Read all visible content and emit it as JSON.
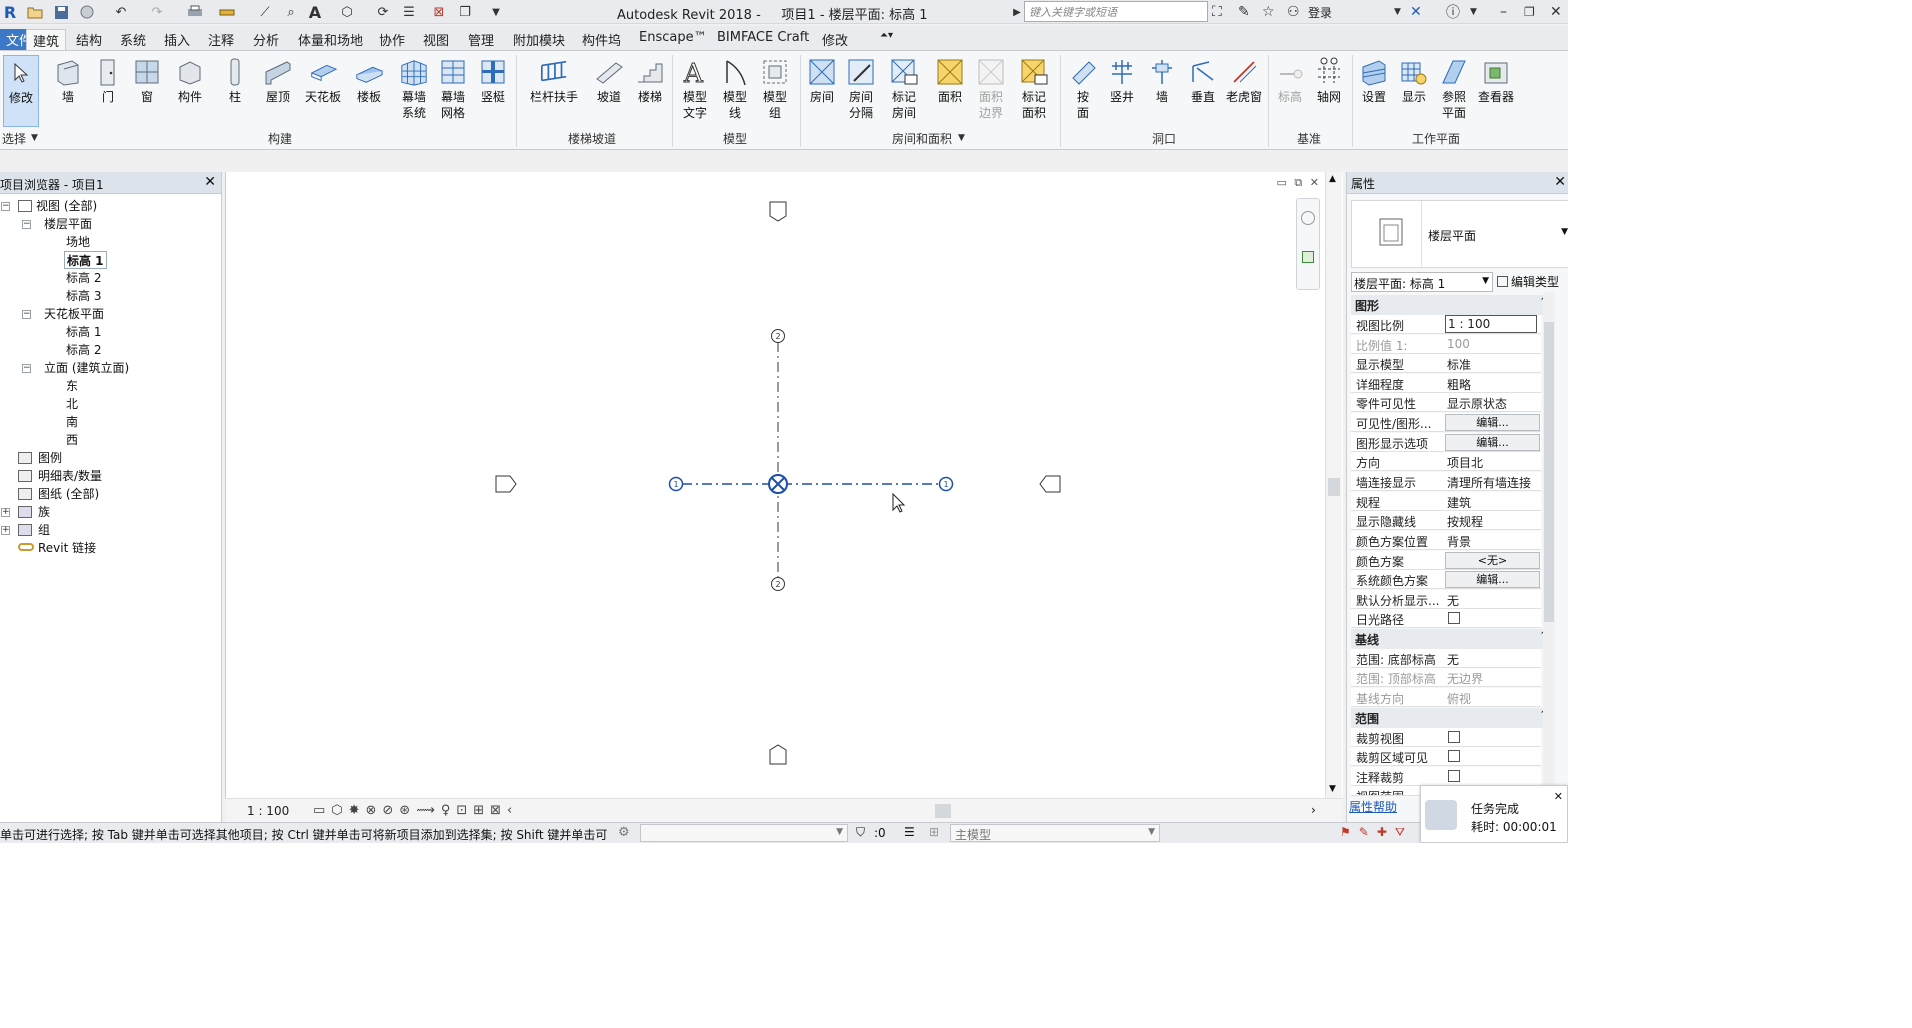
{
  "app": {
    "logo": "R",
    "title": "Autodesk Revit 2018 -     项目1 - 楼层平面: 标高 1",
    "search_placeholder": "键入关键字或短语",
    "login": "登录"
  },
  "tabs": [
    {
      "label": "文件"
    },
    {
      "label": "建筑",
      "active": true
    },
    {
      "label": "结构"
    },
    {
      "label": "系统"
    },
    {
      "label": "插入"
    },
    {
      "label": "注释"
    },
    {
      "label": "分析"
    },
    {
      "label": "体量和场地"
    },
    {
      "label": "协作"
    },
    {
      "label": "视图"
    },
    {
      "label": "管理"
    },
    {
      "label": "附加模块"
    },
    {
      "label": "构件坞"
    },
    {
      "label": "Enscape™"
    },
    {
      "label": "BIMFACE Craft"
    },
    {
      "label": "修改"
    }
  ],
  "ribbon": {
    "buttons": [
      {
        "label": "修改"
      },
      {
        "label": "墙"
      },
      {
        "label": "门"
      },
      {
        "label": "窗"
      },
      {
        "label": "构件"
      },
      {
        "label": "柱"
      },
      {
        "label": "屋顶"
      },
      {
        "label": "天花板"
      },
      {
        "label": "楼板"
      },
      {
        "label": "幕墙\n系统"
      },
      {
        "label": "幕墙\n网格"
      },
      {
        "label": "竖梃"
      },
      {
        "label": "栏杆扶手"
      },
      {
        "label": "坡道"
      },
      {
        "label": "楼梯"
      },
      {
        "label": "模型\n文字"
      },
      {
        "label": "模型\n线"
      },
      {
        "label": "模型\n组"
      },
      {
        "label": "房间"
      },
      {
        "label": "房间\n分隔"
      },
      {
        "label": "标记\n房间"
      },
      {
        "label": "面积"
      },
      {
        "label": "面积\n边界"
      },
      {
        "label": "标记\n面积"
      },
      {
        "label": "按\n面"
      },
      {
        "label": "竖井"
      },
      {
        "label": "墙"
      },
      {
        "label": "垂直"
      },
      {
        "label": "老虎窗"
      },
      {
        "label": "标高"
      },
      {
        "label": "轴网"
      },
      {
        "label": "设置"
      },
      {
        "label": "显示"
      },
      {
        "label": "参照\n平面"
      },
      {
        "label": "查看器"
      }
    ],
    "panels": [
      {
        "label": "选择"
      },
      {
        "label": "构建"
      },
      {
        "label": "楼梯坡道"
      },
      {
        "label": "模型"
      },
      {
        "label": "房间和面积"
      },
      {
        "label": "洞口"
      },
      {
        "label": "基准"
      },
      {
        "label": "工作平面"
      }
    ]
  },
  "browser": {
    "title": "项目浏览器 - 项目1",
    "items": [
      {
        "label": "视图 (全部)"
      },
      {
        "label": "楼层平面"
      },
      {
        "label": "场地"
      },
      {
        "label": "标高 1"
      },
      {
        "label": "标高 2"
      },
      {
        "label": "标高 3"
      },
      {
        "label": "天花板平面"
      },
      {
        "label": "标高 1"
      },
      {
        "label": "标高 2"
      },
      {
        "label": "立面 (建筑立面)"
      },
      {
        "label": "东"
      },
      {
        "label": "北"
      },
      {
        "label": "南"
      },
      {
        "label": "西"
      },
      {
        "label": "图例"
      },
      {
        "label": "明细表/数量"
      },
      {
        "label": "图纸 (全部)"
      },
      {
        "label": "族"
      },
      {
        "label": "组"
      },
      {
        "label": "Revit 链接"
      }
    ]
  },
  "canvas": {
    "scale": "1 : 100",
    "grid_bubbles": [
      "1",
      "1",
      "2",
      "2"
    ]
  },
  "properties": {
    "title": "属性",
    "type_name": "楼层平面",
    "selector": "楼层平面: 标高 1",
    "edit_type": "编辑类型",
    "sections": {
      "graphics": "图形",
      "underlay": "基线",
      "extents": "范围"
    },
    "rows": [
      {
        "k": "视图比例",
        "v": "1 : 100"
      },
      {
        "k": "比例值 1:",
        "v": "100"
      },
      {
        "k": "显示模型",
        "v": "标准"
      },
      {
        "k": "详细程度",
        "v": "粗略"
      },
      {
        "k": "零件可见性",
        "v": "显示原状态"
      },
      {
        "k": "可见性/图形...",
        "v": "编辑..."
      },
      {
        "k": "图形显示选项",
        "v": "编辑..."
      },
      {
        "k": "方向",
        "v": "项目北"
      },
      {
        "k": "墙连接显示",
        "v": "清理所有墙连接"
      },
      {
        "k": "规程",
        "v": "建筑"
      },
      {
        "k": "显示隐藏线",
        "v": "按规程"
      },
      {
        "k": "颜色方案位置",
        "v": "背景"
      },
      {
        "k": "颜色方案",
        "v": "<无>"
      },
      {
        "k": "系统颜色方案",
        "v": "编辑..."
      },
      {
        "k": "默认分析显示...",
        "v": "无"
      },
      {
        "k": "日光路径",
        "v": ""
      },
      {
        "k": "范围: 底部标高",
        "v": "无"
      },
      {
        "k": "范围: 顶部标高",
        "v": "无边界"
      },
      {
        "k": "基线方向",
        "v": "俯视"
      },
      {
        "k": "裁剪视图",
        "v": ""
      },
      {
        "k": "裁剪区域可见",
        "v": ""
      },
      {
        "k": "注释裁剪",
        "v": ""
      },
      {
        "k": "视图范围",
        "v": ""
      }
    ],
    "help_link": "属性帮助"
  },
  "status": {
    "message": "单击可进行选择; 按 Tab 键并单击可选择其他项目; 按 Ctrl 键并单击可将新项目添加到选择集; 按 Shift 键并单击可",
    "filter_count": ":0",
    "main_model": "主模型"
  },
  "toast": {
    "title": "任务完成",
    "elapsed": "耗时: 00:00:01"
  },
  "colors": {
    "accent": "#1e5bb8",
    "grid_line": "#1d4fa8",
    "panel_head": "#dde3ea"
  }
}
